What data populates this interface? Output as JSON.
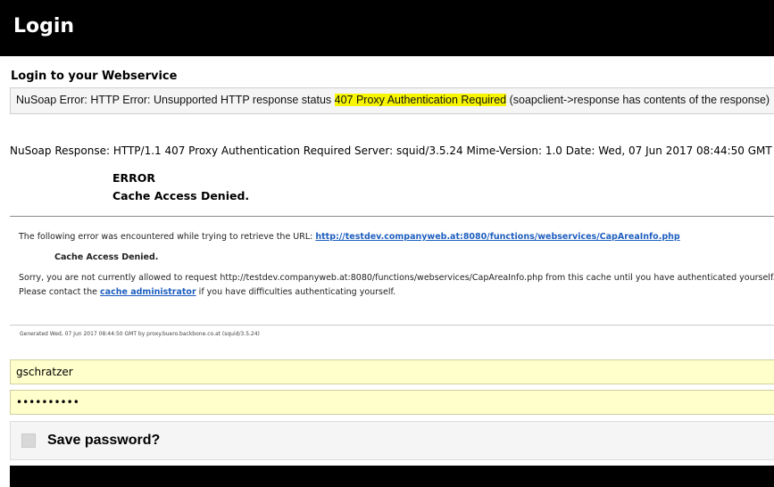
{
  "header": {
    "title": "Login"
  },
  "section": {
    "title": "Login to your Webservice"
  },
  "error": {
    "prefix": "NuSoap Error: HTTP Error: Unsupported HTTP response status ",
    "highlight": "407 Proxy Authentication Required",
    "suffix": " (soapclient->response has contents of the response)",
    "highlight_color": "#f7f500"
  },
  "response": {
    "text": "NuSoap Response: HTTP/1.1 407 Proxy Authentication Required Server: squid/3.5.24 Mime-Version: 1.0 Date: Wed, 07 Jun 2017 08:44:50 GMT"
  },
  "squid": {
    "error_title": "ERROR",
    "error_subtitle": "Cache Access Denied.",
    "url_prefix": "The following error was encountered while trying to retrieve the URL: ",
    "url": "http://testdev.companyweb.at:8080/functions/webservices/CapAreaInfo.php",
    "denied": "Cache Access Denied.",
    "sorry": "Sorry, you are not currently allowed to request http://testdev.companyweb.at:8080/functions/webservices/CapAreaInfo.php from this cache until you have authenticated yourself.",
    "contact_prefix": "Please contact the ",
    "contact_link": "cache administrator",
    "contact_suffix": " if you have difficulties authenticating yourself.",
    "footer": "Generated Wed, 07 Jun 2017 08:44:50 GMT by proxy.buero.backbone.co.at (squid/3.5.24)"
  },
  "form": {
    "username": "gschratzer",
    "password": "••••••••••",
    "save_password_label": "Save password?"
  },
  "colors": {
    "header_bg": "#000000",
    "input_bg": "#ffffcc",
    "link": "#1f5fbf"
  }
}
